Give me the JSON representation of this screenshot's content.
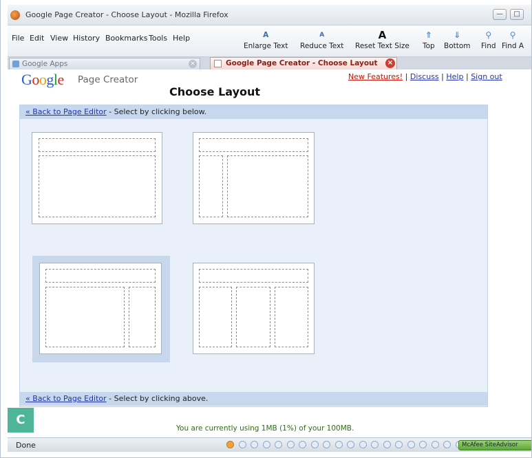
{
  "window": {
    "title": "Google Page Creator - Choose Layout - Mozilla Firefox",
    "minimize_glyph": "—",
    "maximize_glyph": "□"
  },
  "menu": [
    "File",
    "Edit",
    "View",
    "History",
    "Bookmarks",
    "Tools",
    "Help"
  ],
  "toolbar": {
    "enlarge_text": "Enlarge Text",
    "reduce_text": "Reduce Text",
    "reset_text_size": "Reset Text Size",
    "top": "Top",
    "bottom": "Bottom",
    "find": "Find",
    "find_again": "Find A",
    "glyph_a": "A",
    "glyph_up": "⇑",
    "glyph_down": "⇓",
    "glyph_find": "⚲"
  },
  "tabs": [
    {
      "label": "Google Apps",
      "close_glyph": "×"
    },
    {
      "label": "Google Page Creator - Choose Layout",
      "close_glyph": "×"
    }
  ],
  "header": {
    "logo_letters": [
      "G",
      "o",
      "o",
      "g",
      "l",
      "e"
    ],
    "product_name": "Page Creator",
    "page_title": "Choose Layout",
    "links": {
      "new_features": "New Features!",
      "discuss": "Discuss",
      "help": "Help",
      "sign_out": "Sign out",
      "separator": "|"
    }
  },
  "panel": {
    "back_link": "« Back to Page Editor",
    "top_hint": " - Select by clicking below.",
    "bottom_hint": " - Select by clicking above.",
    "layouts": [
      {
        "name": "One column",
        "selected": false
      },
      {
        "name": "Two column (sidebar left)",
        "selected": false
      },
      {
        "name": "Two column (sidebar right)",
        "selected": true
      },
      {
        "name": "Three column",
        "selected": false
      }
    ]
  },
  "usage_text": "You are currently using 1MB (1%) of your 100MB.",
  "badge_letter": "C",
  "status": {
    "done": "Done",
    "mcafee": "McAfee SiteAdvisor"
  },
  "colors": {
    "link": "#2233aa",
    "new_features": "#cc1100",
    "panel_bg": "#e9f0f9",
    "panel_bar": "#c7d8ee",
    "selected_highlight": "#c9d7ec",
    "usage_text": "#2f6d12",
    "badge": "#4fb59a"
  }
}
